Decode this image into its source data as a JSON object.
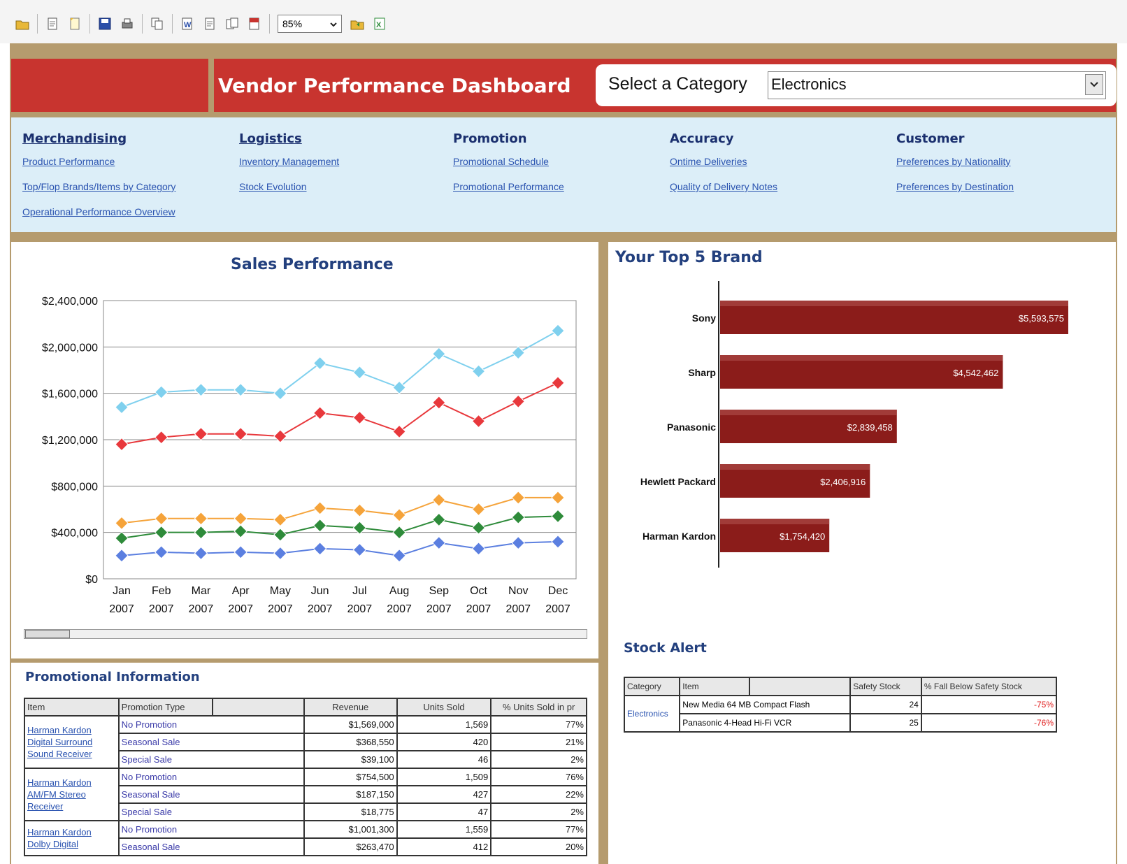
{
  "toolbar": {
    "zoom": "85%",
    "icons": [
      "folder-icon",
      "page-icon",
      "document-icon",
      "save-icon",
      "print-icon",
      "copy-icon",
      "word-icon",
      "page-icon",
      "pages-icon",
      "pdf-icon",
      "open-icon",
      "excel-icon"
    ]
  },
  "header": {
    "title": "Vendor Performance Dashboard",
    "category_label": "Select a Category",
    "category_value": "Electronics"
  },
  "nav": [
    {
      "heading": "Merchandising",
      "links": [
        "Product Performance",
        "Top/Flop Brands/Items by Category",
        "Operational Performance Overview"
      ]
    },
    {
      "heading": "Logistics",
      "links": [
        "Inventory Management",
        "Stock Evolution"
      ]
    },
    {
      "heading": "Promotion",
      "links": [
        "Promotional Schedule",
        "Promotional Performance"
      ]
    },
    {
      "heading": "Accuracy",
      "links": [
        "Ontime Deliveries",
        "Quality of Delivery Notes"
      ]
    },
    {
      "heading": "Customer",
      "links": [
        "Preferences by Nationality",
        "Preferences by Destination"
      ]
    }
  ],
  "chart_data": [
    {
      "type": "line",
      "title": "Sales Performance",
      "x": [
        "Jan 2007",
        "Feb 2007",
        "Mar 2007",
        "Apr 2007",
        "May 2007",
        "Jun 2007",
        "Jul 2007",
        "Aug 2007",
        "Sep 2007",
        "Oct 2007",
        "Nov 2007",
        "Dec 2007"
      ],
      "yticks": [
        "$2,400,000",
        "$2,000,000",
        "$1,600,000",
        "$1,200,000",
        "$800,000",
        "$400,000",
        "$0"
      ],
      "ylim": [
        0,
        2400000
      ],
      "grid": true,
      "series": [
        {
          "color": "#7fd0ee",
          "values": [
            1480000,
            1610000,
            1630000,
            1630000,
            1600000,
            1860000,
            1780000,
            1650000,
            1940000,
            1790000,
            1950000,
            2140000
          ]
        },
        {
          "color": "#e8383c",
          "values": [
            1160000,
            1220000,
            1250000,
            1250000,
            1230000,
            1430000,
            1390000,
            1270000,
            1520000,
            1360000,
            1530000,
            1690000
          ]
        },
        {
          "color": "#f5a33a",
          "values": [
            480000,
            520000,
            520000,
            520000,
            510000,
            610000,
            590000,
            550000,
            680000,
            600000,
            700000,
            700000
          ]
        },
        {
          "color": "#2e8b3a",
          "values": [
            350000,
            400000,
            400000,
            410000,
            380000,
            460000,
            440000,
            400000,
            510000,
            440000,
            530000,
            540000
          ]
        },
        {
          "color": "#5b7fe0",
          "values": [
            200000,
            230000,
            220000,
            230000,
            220000,
            260000,
            250000,
            200000,
            310000,
            260000,
            310000,
            320000
          ]
        }
      ]
    },
    {
      "type": "bar",
      "title": "Your Top 5 Brand",
      "categories": [
        "Sony",
        "Sharp",
        "Panasonic",
        "Hewlett Packard",
        "Harman Kardon"
      ],
      "values": [
        5593575,
        4542462,
        2839458,
        2406916,
        1754420
      ],
      "labels": [
        "$5,593,575",
        "$4,542,462",
        "$2,839,458",
        "$2,406,916",
        "$1,754,420"
      ],
      "color": "#8b1c1a"
    }
  ],
  "promo": {
    "title": "Promotional Information",
    "headers": [
      "Item",
      "Promotion Type",
      "",
      "Revenue",
      "Units Sold",
      "% Units Sold in pr"
    ],
    "groups": [
      {
        "item": "Harman Kardon Digital Surround Sound Receiver",
        "rows": [
          {
            "type": "No Promotion",
            "revenue": "$1,569,000",
            "units": "1,569",
            "pct": "77%"
          },
          {
            "type": "Seasonal Sale",
            "revenue": "$368,550",
            "units": "420",
            "pct": "21%"
          },
          {
            "type": "Special Sale",
            "revenue": "$39,100",
            "units": "46",
            "pct": "2%"
          }
        ]
      },
      {
        "item": "Harman Kardon AM/FM Stereo Receiver",
        "rows": [
          {
            "type": "No Promotion",
            "revenue": "$754,500",
            "units": "1,509",
            "pct": "76%"
          },
          {
            "type": "Seasonal Sale",
            "revenue": "$187,150",
            "units": "427",
            "pct": "22%"
          },
          {
            "type": "Special Sale",
            "revenue": "$18,775",
            "units": "47",
            "pct": "2%"
          }
        ]
      },
      {
        "item": "Harman Kardon Dolby Digital",
        "rows": [
          {
            "type": "No Promotion",
            "revenue": "$1,001,300",
            "units": "1,559",
            "pct": "77%"
          },
          {
            "type": "Seasonal Sale",
            "revenue": "$263,470",
            "units": "412",
            "pct": "20%"
          }
        ]
      }
    ]
  },
  "stock": {
    "title": "Stock Alert",
    "headers": [
      "Category",
      "Item",
      "",
      "Safety Stock",
      "% Fall Below Safety Stock"
    ],
    "category": "Electronics",
    "rows": [
      {
        "item": "New Media 64 MB Compact Flash",
        "safety": "24",
        "fall": "-75%"
      },
      {
        "item": "Panasonic 4-Head Hi-Fi VCR",
        "safety": "25",
        "fall": "-76%"
      }
    ]
  }
}
